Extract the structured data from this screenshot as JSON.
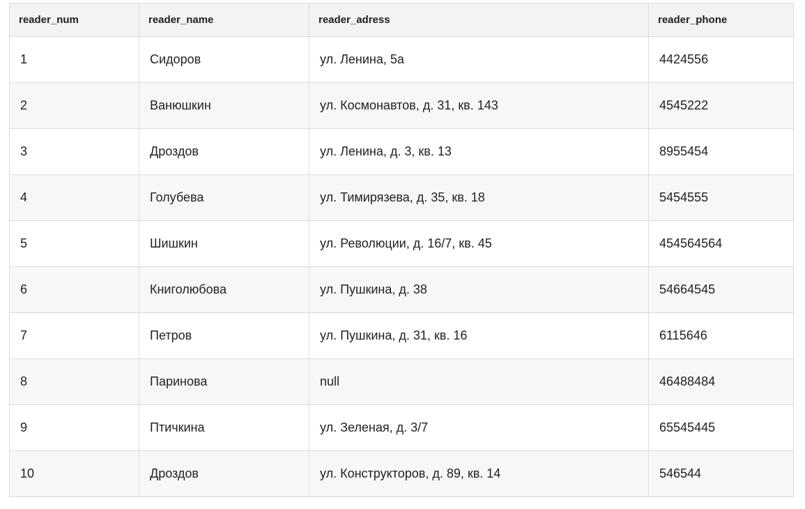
{
  "table": {
    "columns": [
      "reader_num",
      "reader_name",
      "reader_adress",
      "reader_phone"
    ],
    "rows": [
      [
        "1",
        "Сидоров",
        "ул. Ленина, 5а",
        "4424556"
      ],
      [
        "2",
        "Ванюшкин",
        "ул. Космонавтов, д. 31, кв. 143",
        "4545222"
      ],
      [
        "3",
        "Дроздов",
        "ул. Ленина, д. 3, кв. 13",
        "8955454"
      ],
      [
        "4",
        "Голубева",
        "ул. Тимирязева, д. 35, кв. 18",
        "5454555"
      ],
      [
        "5",
        "Шишкин",
        "ул. Революции, д. 16/7, кв. 45",
        "454564564"
      ],
      [
        "6",
        "Книголюбова",
        "ул. Пушкина, д. 38",
        "54664545"
      ],
      [
        "7",
        "Петров",
        "ул. Пушкина, д. 31, кв. 16",
        "6115646"
      ],
      [
        "8",
        "Паринова",
        "null",
        "46488484"
      ],
      [
        "9",
        "Птичкина",
        "ул. Зеленая, д. 3/7",
        "65545445"
      ],
      [
        "10",
        "Дроздов",
        "ул. Конструкторов, д. 89, кв. 14",
        "546544"
      ]
    ]
  },
  "colors": {
    "header_bg": "#f3f3f3",
    "row_alt_bg": "#f7f7f7",
    "border": "#dcdcdc",
    "text": "#212121"
  }
}
